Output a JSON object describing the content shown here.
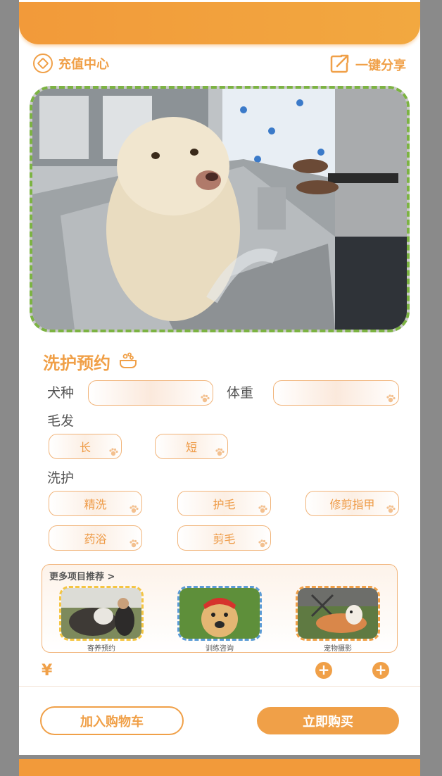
{
  "header": {
    "recharge_label": "充值中心",
    "share_label": "一键分享"
  },
  "section": {
    "title": "洗护预约"
  },
  "form": {
    "breed_label": "犬种",
    "weight_label": "体重",
    "hair_label": "毛发",
    "hair_options": [
      "长",
      "短"
    ],
    "care_label": "洗护",
    "care_options": [
      "精洗",
      "护毛",
      "修剪指甲",
      "药浴",
      "剪毛"
    ]
  },
  "more": {
    "title": "更多项目推荐 >",
    "items": [
      {
        "caption": "寄养预约"
      },
      {
        "caption": "训练咨询"
      },
      {
        "caption": "宠物摄影"
      }
    ]
  },
  "footer": {
    "currency": "¥",
    "add_to_cart": "加入购物车",
    "buy_now": "立即购买"
  },
  "colors": {
    "accent": "#f0a048",
    "hero_border": "#7cb342"
  }
}
